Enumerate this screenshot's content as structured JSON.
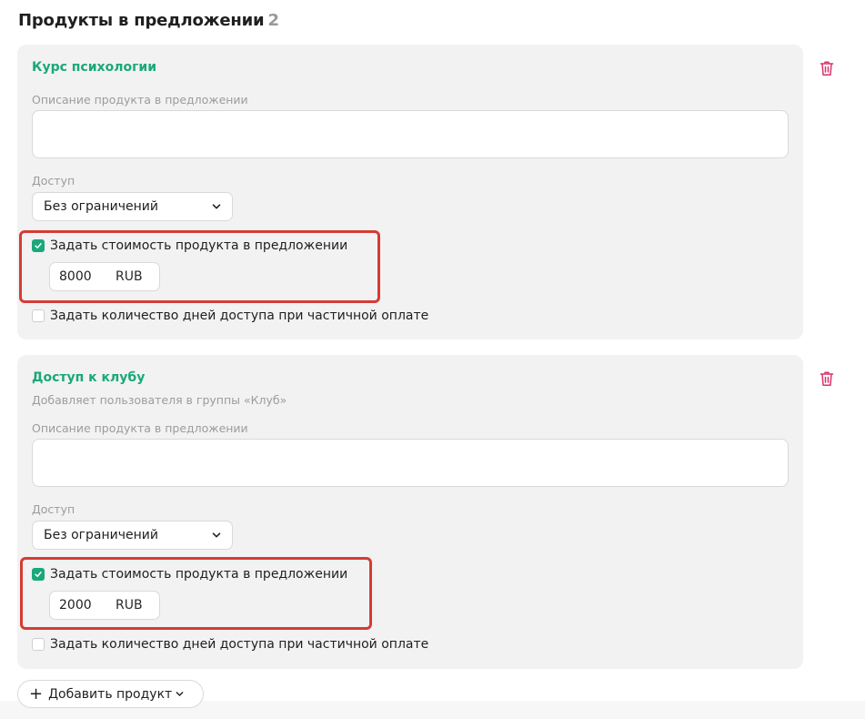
{
  "section": {
    "title": "Продукты в предложении",
    "count": "2"
  },
  "products": [
    {
      "title": "Курс психологии",
      "subtitle": "",
      "description_label": "Описание продукта в предложении",
      "description_value": "",
      "access_label": "Доступ",
      "access_value": "Без ограничений",
      "set_price_label": "Задать стоимость продукта в предложении",
      "set_price_checked": true,
      "price_amount": "8000",
      "price_currency": "RUB",
      "partial_days_label": "Задать количество дней доступа при частичной оплате",
      "partial_days_checked": false
    },
    {
      "title": "Доступ к клубу",
      "subtitle": "Добавляет пользователя в группы «Клуб»",
      "description_label": "Описание продукта в предложении",
      "description_value": "",
      "access_label": "Доступ",
      "access_value": "Без ограничений",
      "set_price_label": "Задать стоимость продукта в предложении",
      "set_price_checked": true,
      "price_amount": "2000",
      "price_currency": "RUB",
      "partial_days_label": "Задать количество дней доступа при частичной оплате",
      "partial_days_checked": false
    }
  ],
  "add_button": {
    "label": "Добавить продукт"
  },
  "icons": {
    "delete": "trash-icon",
    "dropdown": "chevron-down-icon",
    "check": "checkmark-icon",
    "add": "plus-icon"
  },
  "colors": {
    "accent": "#1aa87a",
    "delete": "#d6336c",
    "highlight": "#d63b35",
    "card": "#f2f2f2"
  }
}
